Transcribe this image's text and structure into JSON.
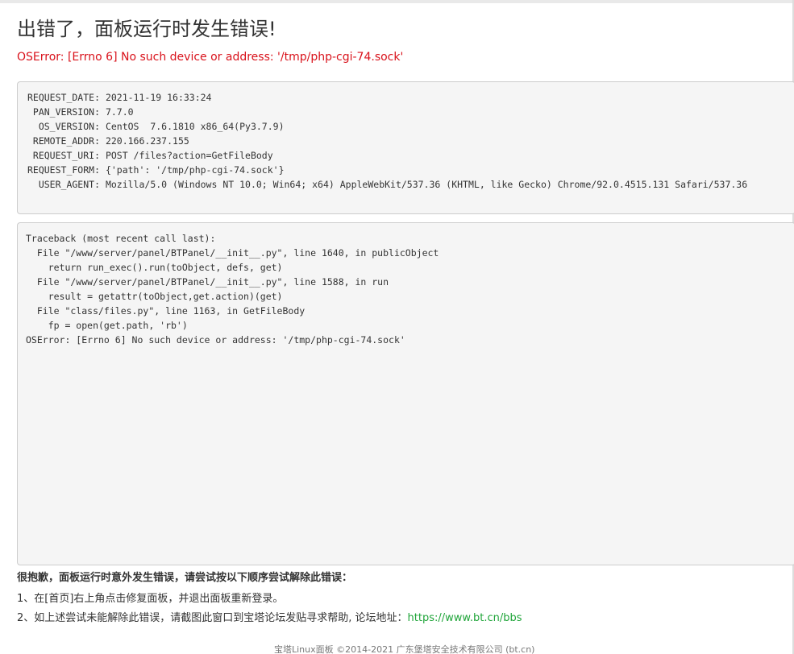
{
  "page": {
    "title": "出错了，面板运行时发生错误!",
    "error_summary": "OSError: [Errno 6] No such device or address: '/tmp/php-cgi-74.sock'"
  },
  "request_info": [
    {
      "key": "REQUEST_DATE:",
      "value": "2021-11-19 16:33:24"
    },
    {
      "key": "PAN_VERSION:",
      "value": "7.7.0"
    },
    {
      "key": "OS_VERSION:",
      "value": "CentOS  7.6.1810 x86_64(Py3.7.9)"
    },
    {
      "key": "REMOTE_ADDR:",
      "value": "220.166.237.155"
    },
    {
      "key": "REQUEST_URI:",
      "value": "POST /files?action=GetFileBody"
    },
    {
      "key": "REQUEST_FORM:",
      "value": "{'path': '/tmp/php-cgi-74.sock'}"
    },
    {
      "key": "USER_AGENT:",
      "value": "Mozilla/5.0 (Windows NT 10.0; Win64; x64) AppleWebKit/537.36 (KHTML, like Gecko) Chrome/92.0.4515.131 Safari/537.36"
    }
  ],
  "traceback": [
    "Traceback (most recent call last):",
    "  File \"/www/server/panel/BTPanel/__init__.py\", line 1640, in publicObject",
    "    return run_exec().run(toObject, defs, get)",
    "  File \"/www/server/panel/BTPanel/__init__.py\", line 1588, in run",
    "    result = getattr(toObject,get.action)(get)",
    "  File \"class/files.py\", line 1163, in GetFileBody",
    "    fp = open(get.path, 'rb')",
    "OSError: [Errno 6] No such device or address: '/tmp/php-cgi-74.sock'"
  ],
  "help": {
    "title": "很抱歉，面板运行时意外发生错误，请尝试按以下顺序尝试解除此错误：",
    "step1": "1、在[首页]右上角点击修复面板，并退出面板重新登录。",
    "step2_prefix": "2、如上述尝试未能解除此错误，请截图此窗口到宝塔论坛发贴寻求帮助, 论坛地址：",
    "forum_url": "https://www.bt.cn/bbs"
  },
  "footer": {
    "text": "宝塔Linux面板 ©2014-2021 广东堡塔安全技术有限公司 (bt.cn)"
  },
  "colors": {
    "error_red": "#d9121b",
    "link_green": "#20a53a",
    "code_bg": "#f5f5f5"
  }
}
